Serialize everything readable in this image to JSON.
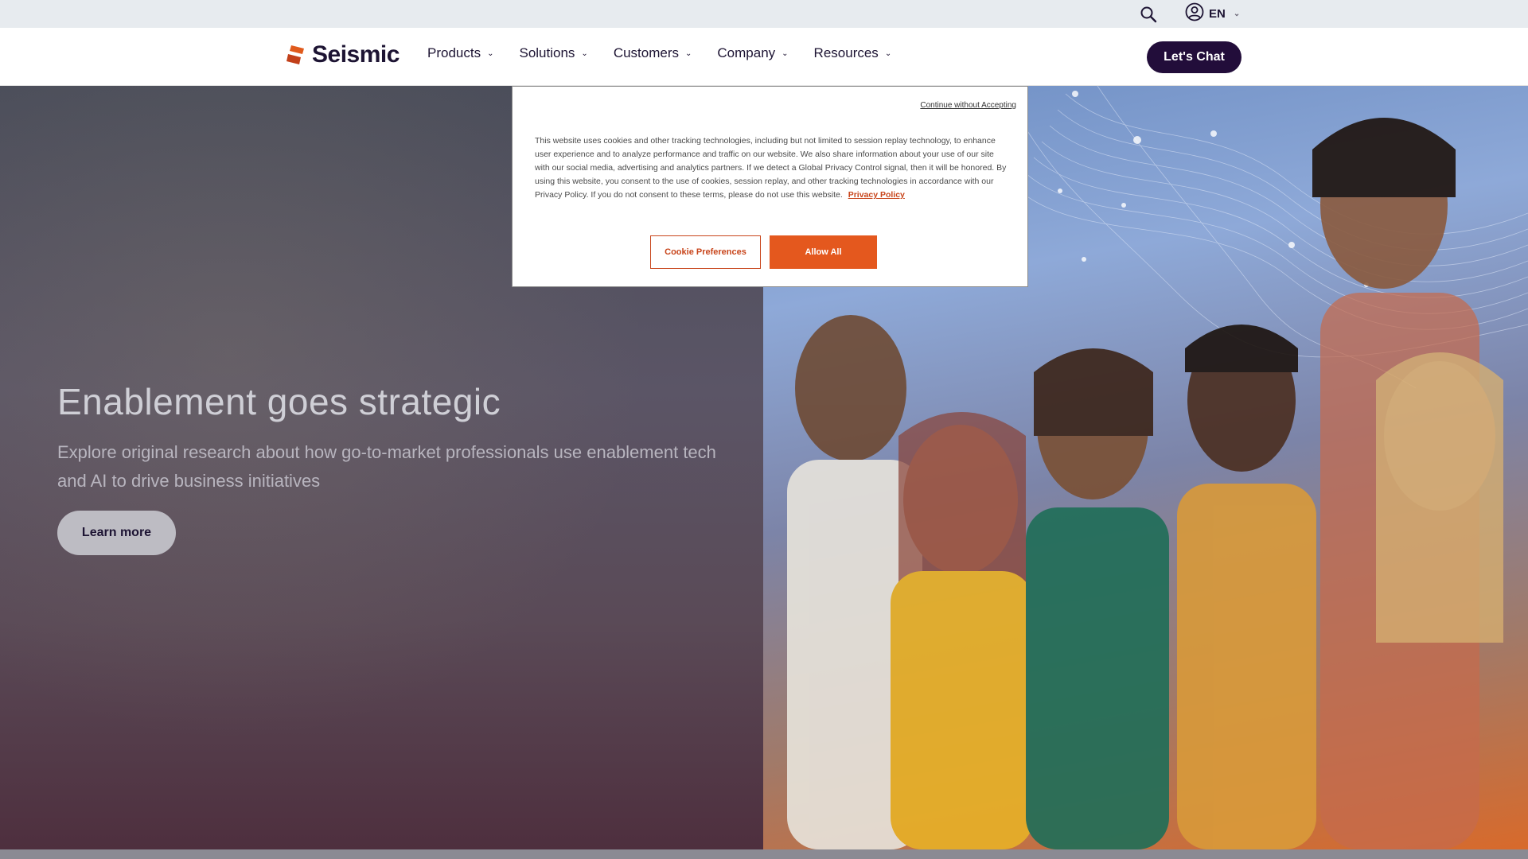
{
  "utility_bar": {
    "search_icon": "search-icon",
    "account_icon": "user-circle-icon",
    "language": "EN"
  },
  "nav": {
    "logo_text": "Seismic",
    "items": [
      {
        "label": "Products"
      },
      {
        "label": "Solutions"
      },
      {
        "label": "Customers"
      },
      {
        "label": "Company"
      },
      {
        "label": "Resources"
      }
    ],
    "chat_button": "Let's Chat"
  },
  "hero": {
    "title": "Enablement goes strategic",
    "subtitle": "Explore original research about how go-to-market professionals use enablement tech and AI to drive business initiatives",
    "cta": "Learn more"
  },
  "cookie_banner": {
    "continue_link": "Continue without Accepting",
    "body": "This website uses cookies and other tracking technologies, including but not limited to session replay technology, to enhance user experience and to analyze performance and traffic on our website. We also share information about your use of our site with our social media, advertising and analytics partners. If we detect a Global Privacy Control signal, then it will be honored. By using this website, you consent to the use of cookies, session replay, and other tracking technologies in accordance with our Privacy Policy. If you do not consent to these terms, please do not use this website.",
    "privacy_link": "Privacy Policy",
    "preferences_button": "Cookie Preferences",
    "allow_button": "Allow All"
  },
  "colors": {
    "brand_navy": "#220d3a",
    "brand_orange": "#e4581e",
    "logo_orange": "#e05a1c"
  }
}
